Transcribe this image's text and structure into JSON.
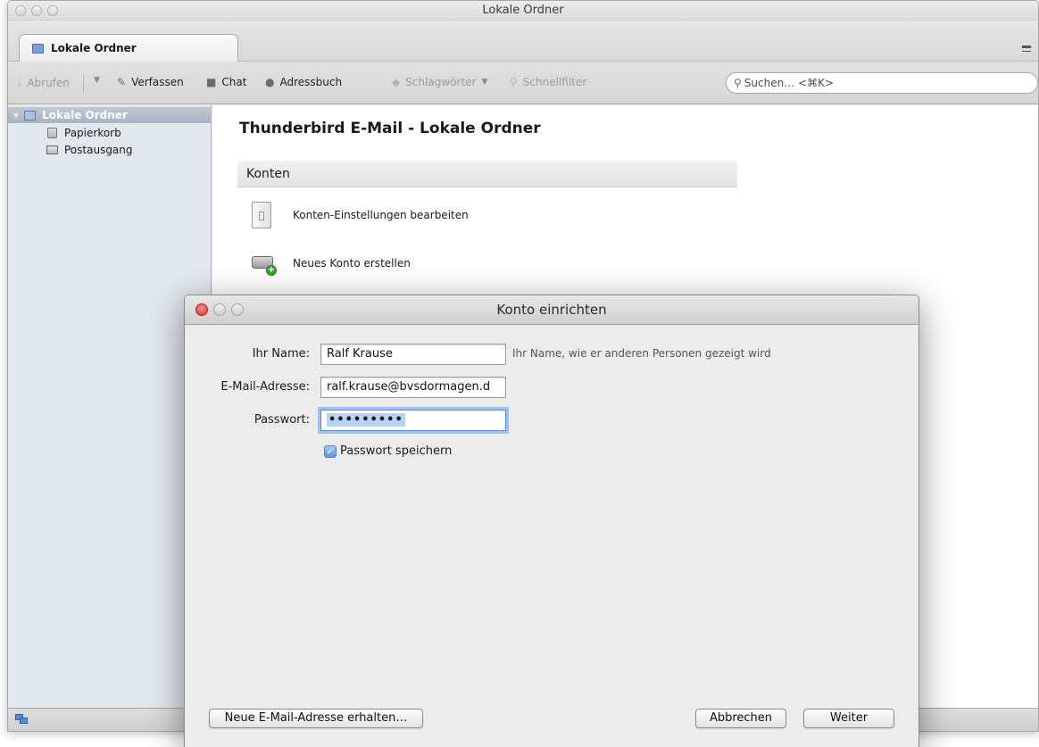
{
  "window": {
    "title": "Lokale Ordner"
  },
  "tabs": [
    {
      "label": "Lokale Ordner"
    }
  ],
  "toolbar": {
    "get_mail": "Abrufen",
    "write": "Verfassen",
    "chat": "Chat",
    "address_book": "Adressbuch",
    "tags": "Schlagwörter",
    "quick_filter": "Schnellfilter",
    "search_placeholder": "Suchen… <⌘K>"
  },
  "sidebar": {
    "items": [
      {
        "label": "Lokale Ordner",
        "selected": true
      },
      {
        "label": "Papierkorb"
      },
      {
        "label": "Postausgang"
      }
    ]
  },
  "content": {
    "title": "Thunderbird E-Mail - Lokale Ordner",
    "section_header": "Konten",
    "actions": {
      "edit_settings": "Konten-Einstellungen bearbeiten",
      "new_account": "Neues Konto erstellen"
    }
  },
  "dialog": {
    "title": "Konto einrichten",
    "name_label": "Ihr Name:",
    "name_value": "Ralf Krause",
    "name_hint": "Ihr Name, wie er anderen Personen gezeigt wird",
    "email_label": "E-Mail-Adresse:",
    "email_value": "ralf.krause@bvsdormagen.d",
    "password_label": "Passwort:",
    "password_value": "•••••••••",
    "remember_password": "Passwort speichern",
    "get_new_email": "Neue E-Mail-Adresse erhalten…",
    "cancel": "Abbrechen",
    "next": "Weiter"
  }
}
